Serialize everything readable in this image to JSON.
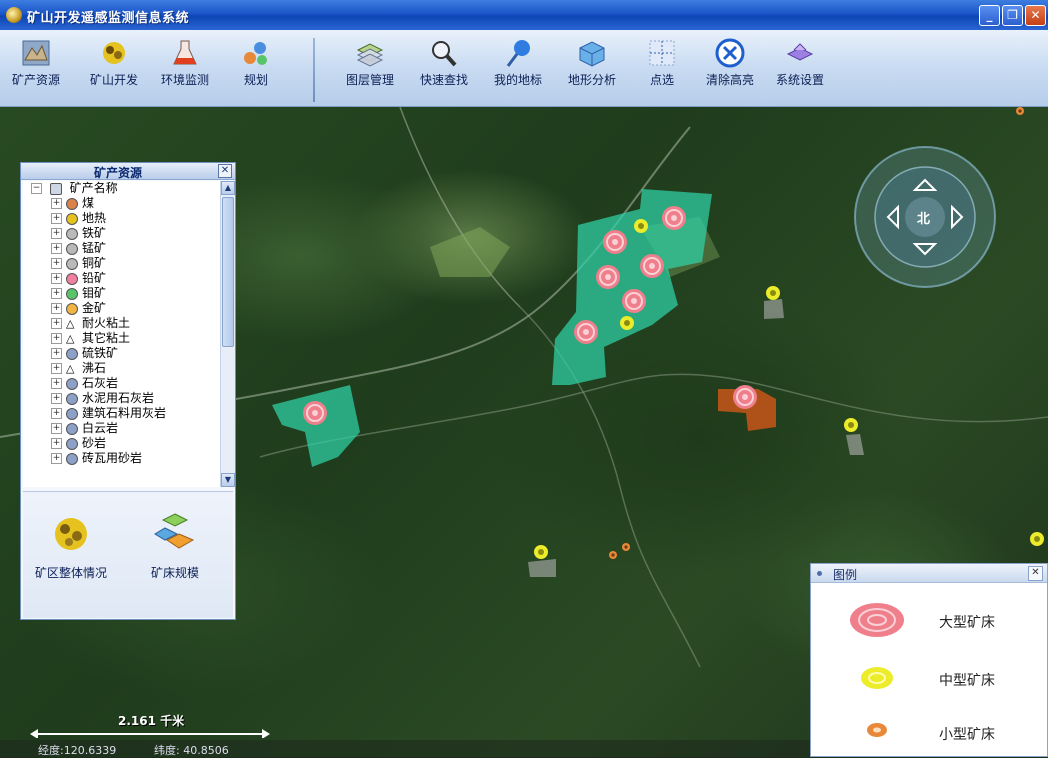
{
  "window": {
    "title": "矿山开发遥感监测信息系统",
    "controls": {
      "minimize": "_",
      "restore": "❐",
      "close": "✕"
    }
  },
  "toolbar": {
    "tools": [
      {
        "label": "矿产资源",
        "icon": "mineral-resources-icon"
      },
      {
        "label": "矿山开发",
        "icon": "mine-development-icon"
      },
      {
        "label": "环境监测",
        "icon": "environment-monitoring-icon"
      },
      {
        "label": "规划",
        "icon": "planning-icon"
      },
      {
        "label": "图层管理",
        "icon": "layer-management-icon"
      },
      {
        "label": "快速查找",
        "icon": "quick-search-icon"
      },
      {
        "label": "我的地标",
        "icon": "my-landmark-icon"
      },
      {
        "label": "地形分析",
        "icon": "terrain-analysis-icon"
      },
      {
        "label": "点选",
        "icon": "point-select-icon"
      },
      {
        "label": "清除高亮",
        "icon": "clear-highlight-icon"
      },
      {
        "label": "系统设置",
        "icon": "system-settings-icon"
      }
    ]
  },
  "tree_panel": {
    "title": "矿产资源",
    "close": "✕",
    "root": "矿产名称",
    "items": [
      {
        "label": "煤",
        "color": "#d9824a"
      },
      {
        "label": "地热",
        "color": "#e6c21e"
      },
      {
        "label": "铁矿",
        "color": "#b9b9b9"
      },
      {
        "label": "锰矿",
        "color": "#b9b9b9"
      },
      {
        "label": "铜矿",
        "color": "#b9b9b9"
      },
      {
        "label": "铅矿",
        "color": "#f07fa0"
      },
      {
        "label": "钼矿",
        "color": "#58c46a"
      },
      {
        "label": "金矿",
        "color": "#f2b544"
      },
      {
        "label": "耐火粘土",
        "color": "triangle"
      },
      {
        "label": "其它粘土",
        "color": "triangle"
      },
      {
        "label": "硫铁矿",
        "color": "#8da0c8"
      },
      {
        "label": "沸石",
        "color": "triangle"
      },
      {
        "label": "石灰岩",
        "color": "#8da0c8"
      },
      {
        "label": "水泥用石灰岩",
        "color": "#8da0c8"
      },
      {
        "label": "建筑石料用灰岩",
        "color": "#8da0c8"
      },
      {
        "label": "白云岩",
        "color": "#8da0c8"
      },
      {
        "label": "砂岩",
        "color": "#8da0c8"
      },
      {
        "label": "砖瓦用砂岩",
        "color": "#8da0c8"
      }
    ],
    "bottom": [
      {
        "label": "矿区整体情况"
      },
      {
        "label": "矿床规模"
      }
    ]
  },
  "compass": {
    "north": "北"
  },
  "legend": {
    "title": "图例",
    "close": "✕",
    "items": [
      {
        "label": "大型矿床",
        "color": "#f07f8c"
      },
      {
        "label": "中型矿床",
        "color": "#ecec2a"
      },
      {
        "label": "小型矿床",
        "color": "#e8893a"
      }
    ]
  },
  "status": {
    "scale": "2.161 千米",
    "longitude": "经度:120.6339",
    "latitude": "纬度: 40.8506"
  },
  "colors": {
    "mining_area": "#2fd3a8",
    "disturbed_area": "#c8561a",
    "title_blue": "#1b56c9"
  }
}
